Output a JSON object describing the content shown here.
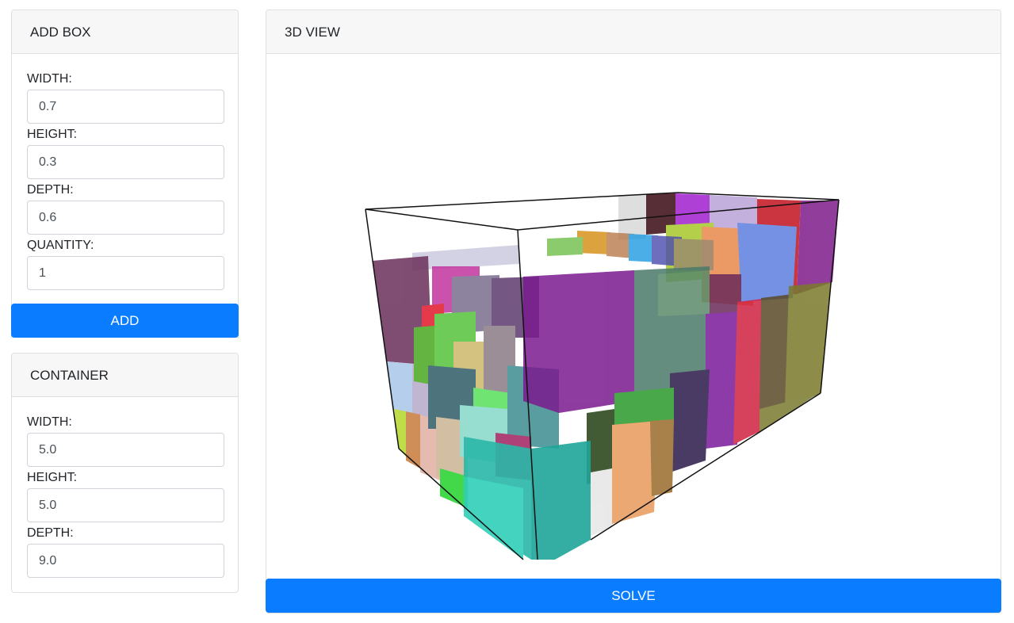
{
  "add_box": {
    "title": "ADD BOX",
    "width_label": "WIDTH:",
    "width_value": "0.7",
    "height_label": "HEIGHT:",
    "height_value": "0.3",
    "depth_label": "DEPTH:",
    "depth_value": "0.6",
    "quantity_label": "QUANTITY:",
    "quantity_value": "1",
    "add_label": "ADD"
  },
  "container": {
    "title": "CONTAINER",
    "width_label": "WIDTH:",
    "width_value": "5.0",
    "height_label": "HEIGHT:",
    "height_value": "5.0",
    "depth_label": "DEPTH:",
    "depth_value": "9.0"
  },
  "view": {
    "title": "3D VIEW",
    "solve_label": "SOLVE"
  },
  "colors": {
    "primary": "#0a7cff",
    "header_bg": "#f7f7f7",
    "border": "#dfdfdf"
  }
}
